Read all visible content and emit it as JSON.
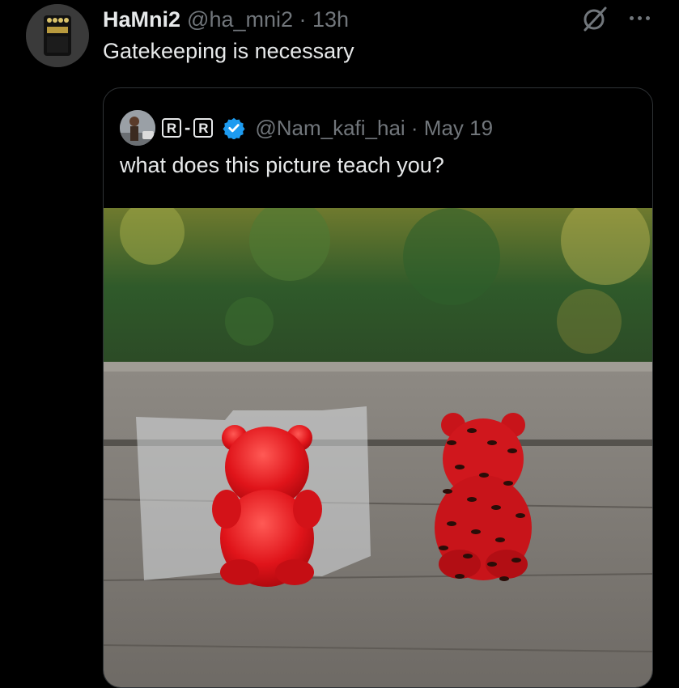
{
  "tweet": {
    "display_name": "HaMni2",
    "handle_time": "@ha_mni2 · 13h",
    "text": "Gatekeeping is necessary",
    "avatar_icon": "guitar-pedal-avatar-icon",
    "more_icon": "more-dots-icon",
    "grok_icon": "grok-icon"
  },
  "quoted": {
    "name_letters": [
      "R",
      "R"
    ],
    "name_separator": "-",
    "verified_icon": "verified-badge-icon",
    "handle_date": "@Nam_kafi_hai · May 19",
    "text": "what does this picture teach you?",
    "image_icon": "gummy-bears-ants-photo"
  },
  "colors": {
    "background": "#000000",
    "text_primary": "#e7e9ea",
    "text_secondary": "#71767b",
    "border": "#2f3336",
    "verified": "#1d9bf0"
  }
}
